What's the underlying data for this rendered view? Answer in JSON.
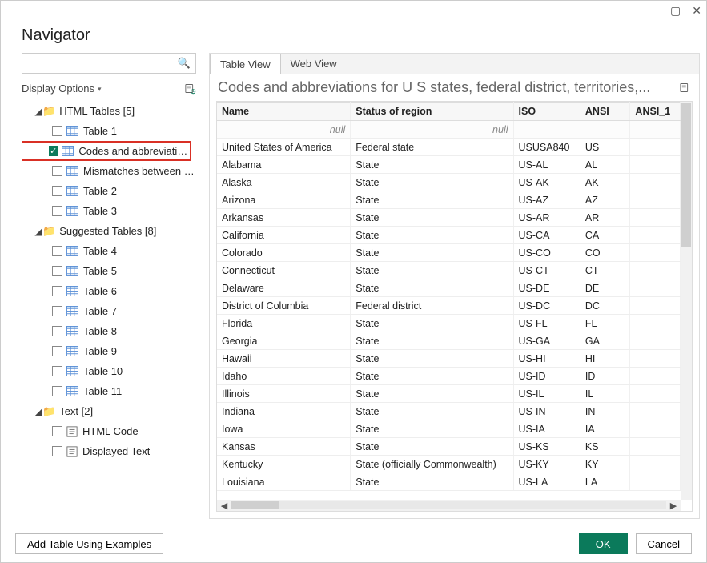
{
  "window": {
    "title": "Navigator"
  },
  "left": {
    "display_options": "Display Options",
    "folders": [
      {
        "label": "HTML Tables [5]",
        "children": [
          {
            "label": "Table 1",
            "checked": false
          },
          {
            "label": "Codes and abbreviations f...",
            "checked": true,
            "highlight": true
          },
          {
            "label": "Mismatches between USP...",
            "checked": false
          },
          {
            "label": "Table 2",
            "checked": false
          },
          {
            "label": "Table 3",
            "checked": false
          }
        ]
      },
      {
        "label": "Suggested Tables [8]",
        "children": [
          {
            "label": "Table 4",
            "checked": false
          },
          {
            "label": "Table 5",
            "checked": false
          },
          {
            "label": "Table 6",
            "checked": false
          },
          {
            "label": "Table 7",
            "checked": false
          },
          {
            "label": "Table 8",
            "checked": false
          },
          {
            "label": "Table 9",
            "checked": false
          },
          {
            "label": "Table 10",
            "checked": false
          },
          {
            "label": "Table 11",
            "checked": false
          }
        ]
      },
      {
        "label": "Text [2]",
        "children": [
          {
            "label": "HTML Code",
            "checked": false,
            "text": true
          },
          {
            "label": "Displayed Text",
            "checked": false,
            "text": true
          }
        ]
      }
    ]
  },
  "tabs": {
    "active": "Table View",
    "other": "Web View"
  },
  "preview": {
    "title": "Codes and abbreviations for U S states, federal district, territories,...",
    "null_label": "null",
    "columns": [
      "Name",
      "Status of region",
      "ISO",
      "ANSI",
      "ANSI_1"
    ],
    "rows": [
      [
        "United States of America",
        "Federal state",
        "USUSA840",
        "US",
        ""
      ],
      [
        "Alabama",
        "State",
        "US-AL",
        "AL",
        ""
      ],
      [
        "Alaska",
        "State",
        "US-AK",
        "AK",
        ""
      ],
      [
        "Arizona",
        "State",
        "US-AZ",
        "AZ",
        ""
      ],
      [
        "Arkansas",
        "State",
        "US-AR",
        "AR",
        ""
      ],
      [
        "California",
        "State",
        "US-CA",
        "CA",
        ""
      ],
      [
        "Colorado",
        "State",
        "US-CO",
        "CO",
        ""
      ],
      [
        "Connecticut",
        "State",
        "US-CT",
        "CT",
        ""
      ],
      [
        "Delaware",
        "State",
        "US-DE",
        "DE",
        ""
      ],
      [
        "District of Columbia",
        "Federal district",
        "US-DC",
        "DC",
        ""
      ],
      [
        "Florida",
        "State",
        "US-FL",
        "FL",
        ""
      ],
      [
        "Georgia",
        "State",
        "US-GA",
        "GA",
        ""
      ],
      [
        "Hawaii",
        "State",
        "US-HI",
        "HI",
        ""
      ],
      [
        "Idaho",
        "State",
        "US-ID",
        "ID",
        ""
      ],
      [
        "Illinois",
        "State",
        "US-IL",
        "IL",
        ""
      ],
      [
        "Indiana",
        "State",
        "US-IN",
        "IN",
        ""
      ],
      [
        "Iowa",
        "State",
        "US-IA",
        "IA",
        ""
      ],
      [
        "Kansas",
        "State",
        "US-KS",
        "KS",
        ""
      ],
      [
        "Kentucky",
        "State (officially Commonwealth)",
        "US-KY",
        "KY",
        ""
      ],
      [
        "Louisiana",
        "State",
        "US-LA",
        "LA",
        ""
      ]
    ]
  },
  "footer": {
    "add_table": "Add Table Using Examples",
    "ok": "OK",
    "cancel": "Cancel"
  }
}
